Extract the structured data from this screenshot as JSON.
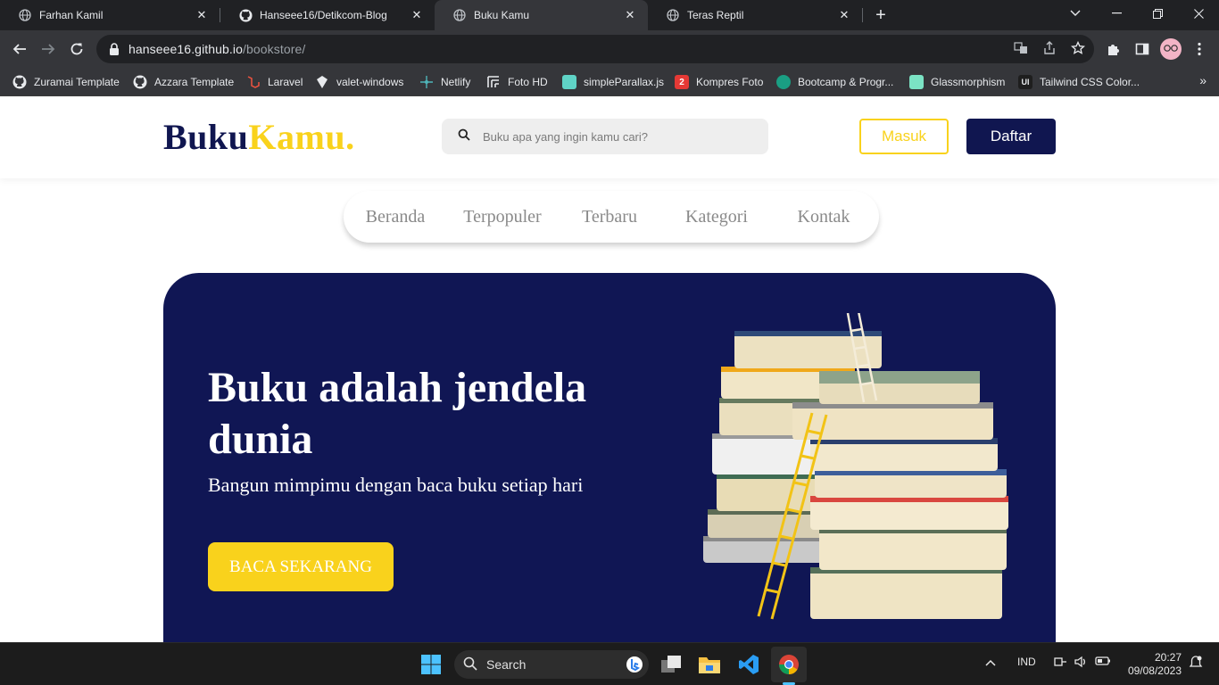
{
  "browser": {
    "tabs": [
      {
        "title": "Farhan Kamil",
        "favicon": "globe-icon",
        "active": false
      },
      {
        "title": "Hanseee16/Detikcom-Blog",
        "favicon": "github-icon",
        "active": false
      },
      {
        "title": "Buku Kamu",
        "favicon": "globe-icon",
        "active": true
      },
      {
        "title": "Teras Reptil",
        "favicon": "globe-icon",
        "active": false
      }
    ],
    "address": {
      "host": "hanseee16.github.io",
      "path": "/bookstore/"
    },
    "bookmarks": [
      {
        "label": "Zuramai Template",
        "icon": "github-icon"
      },
      {
        "label": "Azzara Template",
        "icon": "github-icon"
      },
      {
        "label": "Laravel",
        "icon": "laravel-icon"
      },
      {
        "label": "valet-windows",
        "icon": "valet-icon"
      },
      {
        "label": "Netlify",
        "icon": "netlify-icon"
      },
      {
        "label": "Foto HD",
        "icon": "foto-hd-icon"
      },
      {
        "label": "simpleParallax.js",
        "icon": "parallax-icon"
      },
      {
        "label": "Kompres Foto",
        "icon": "kompres-icon"
      },
      {
        "label": "Bootcamp & Progr...",
        "icon": "bootcamp-icon"
      },
      {
        "label": "Glassmorphism",
        "icon": "glassmorphism-icon"
      },
      {
        "label": "Tailwind CSS Color...",
        "icon": "tailwind-ui-icon"
      }
    ],
    "ui_badge": "UI",
    "kompres_badge": "2"
  },
  "site": {
    "logo_part1": "Buku",
    "logo_part2": "Kamu.",
    "search_placeholder": "Buku apa yang ingin kamu cari?",
    "login_label": "Masuk",
    "register_label": "Daftar",
    "menu": [
      "Beranda",
      "Terpopuler",
      "Terbaru",
      "Kategori",
      "Kontak"
    ],
    "hero": {
      "title": "Buku adalah jendela dunia",
      "subtitle": "Bangun mimpimu dengan baca buku setiap hari",
      "cta": "BACA SEKARANG"
    },
    "colors": {
      "navy": "#101650",
      "yellow": "#f9d21c"
    }
  },
  "taskbar": {
    "search_label": "Search",
    "language": "IND",
    "time": "20:27",
    "date": "09/08/2023"
  }
}
